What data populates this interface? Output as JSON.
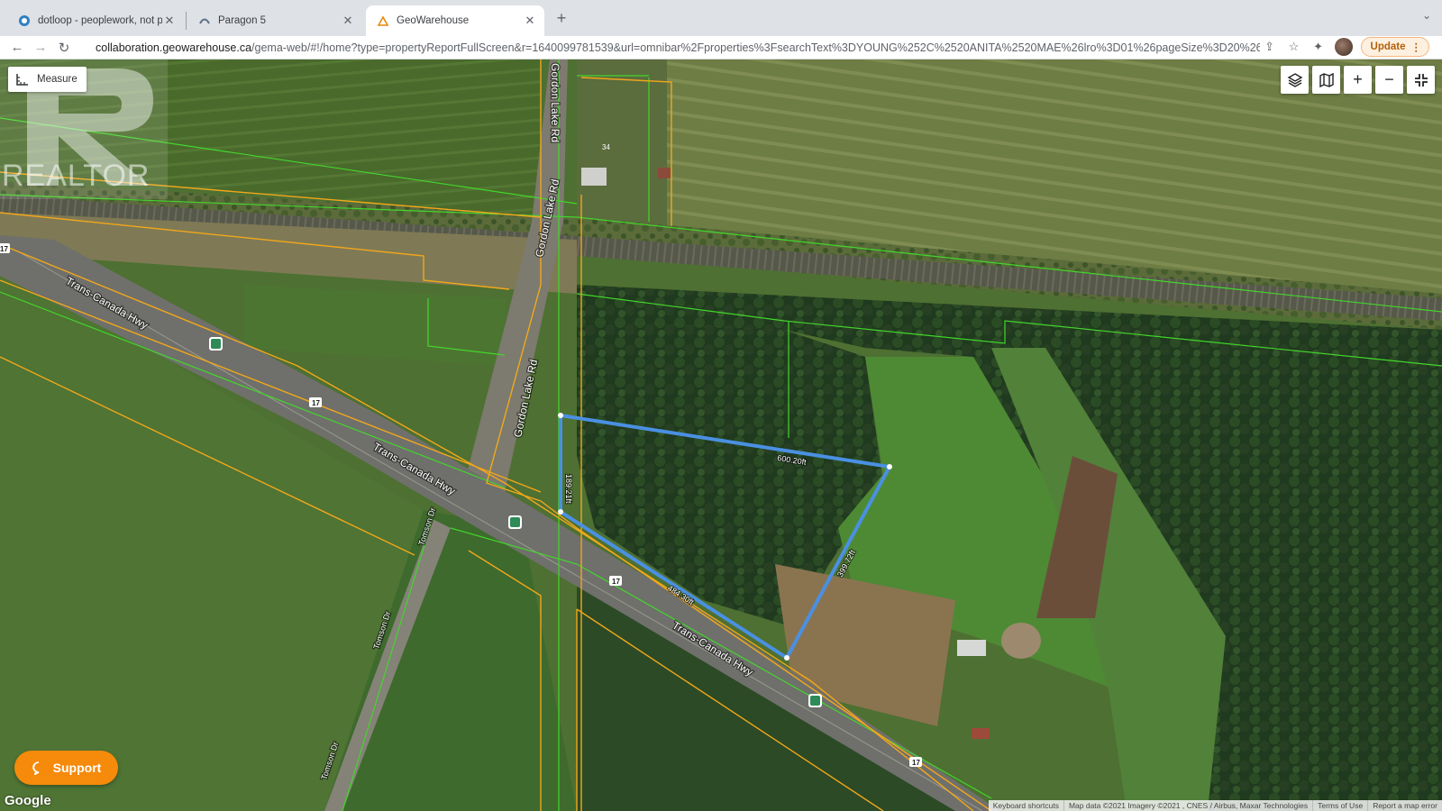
{
  "browser": {
    "tabs": [
      {
        "title": "dotloop - peoplework, not pap",
        "favicon": "dotloop-icon",
        "active": false
      },
      {
        "title": "Paragon 5",
        "favicon": "paragon-icon",
        "active": false
      },
      {
        "title": "GeoWarehouse",
        "favicon": "geowarehouse-icon",
        "active": true
      }
    ],
    "new_tab": "+",
    "url_host": "collaboration.geowarehouse.ca",
    "url_path": "/gema-web/#!/home?type=propertyReportFullScreen&r=1640099781539&url=omnibar%2Fproperties%3FsearchText%3DYOUNG%252C%2520ANITA%2520MAE%26lro%3D01%26pageSize%3D20%26...",
    "update_label": "Update"
  },
  "map": {
    "measure_label": "Measure",
    "watermark_text": "REALTOR",
    "controls": [
      "layers-icon",
      "map-icon",
      "zoom-in-icon",
      "zoom-out-icon",
      "fullscreen-exit-icon"
    ],
    "road_labels": {
      "gordon_top": "Gordon Lake Rd",
      "gordon_mid": "Gordon Lake Rd",
      "gordon_low": "Gordon Lake Rd",
      "transcanada_1": "Trans-Canada Hwy",
      "transcanada_2": "Trans-Canada Hwy",
      "transcanada_3": "Trans-Canada Hwy",
      "tomson_1": "Tomson Dr",
      "tomson_2": "Tomson Dr",
      "tomson_3": "Tomson Dr"
    },
    "highway_shields": [
      "17",
      "17",
      "17",
      "17",
      "17"
    ],
    "lot_number": "34",
    "measurements": {
      "top_edge": "600.20ft",
      "right_edge": "399.72ft",
      "bottom_edge": "484.30ft",
      "left_edge": "189.21ft"
    },
    "support_label": "Support",
    "google_label": "Google",
    "attribution": [
      "Keyboard shortcuts",
      "Map data ©2021 Imagery ©2021 , CNES / Airbus, Maxar Technologies",
      "Terms of Use",
      "Report a map error"
    ]
  },
  "colors": {
    "parcel_orange": "#f2a71b",
    "parcel_green": "#43d62c",
    "measure_blue": "#4a90e2",
    "support_orange": "#f58a0b"
  }
}
